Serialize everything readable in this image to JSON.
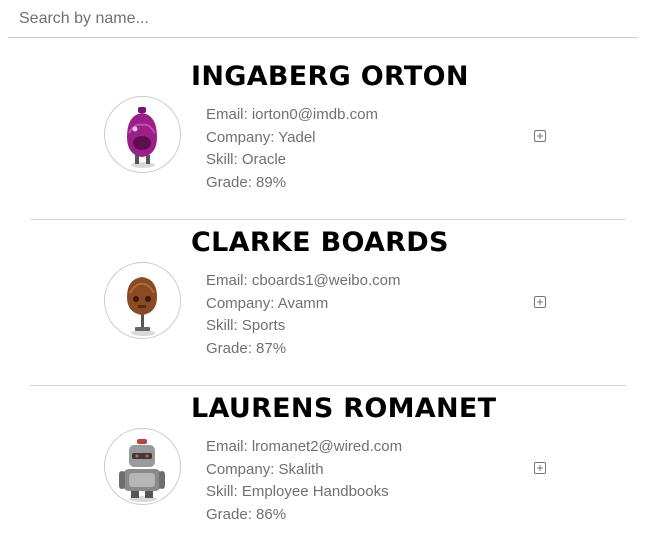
{
  "search": {
    "placeholder": "Search by name..."
  },
  "students": [
    {
      "name": "INGABERG ORTON",
      "email_label": "Email: iorton0@imdb.com",
      "company_label": "Company: Yadel",
      "skill_label": "Skill: Oracle",
      "grade_label": "Grade: 89%",
      "avatar_color": "#9a1f86",
      "expand_icon": "plus-box-icon"
    },
    {
      "name": "CLARKE BOARDS",
      "email_label": "Email: cboards1@weibo.com",
      "company_label": "Company: Avamm",
      "skill_label": "Skill: Sports",
      "grade_label": "Grade: 87%",
      "avatar_color": "#8a4a22",
      "expand_icon": "plus-box-icon"
    },
    {
      "name": "LAURENS ROMANET",
      "email_label": "Email: lromanet2@wired.com",
      "company_label": "Company: Skalith",
      "skill_label": "Skill: Employee Handbooks",
      "grade_label": "Grade: 86%",
      "avatar_color": "#8a8a8a",
      "expand_icon": "plus-box-icon"
    }
  ]
}
